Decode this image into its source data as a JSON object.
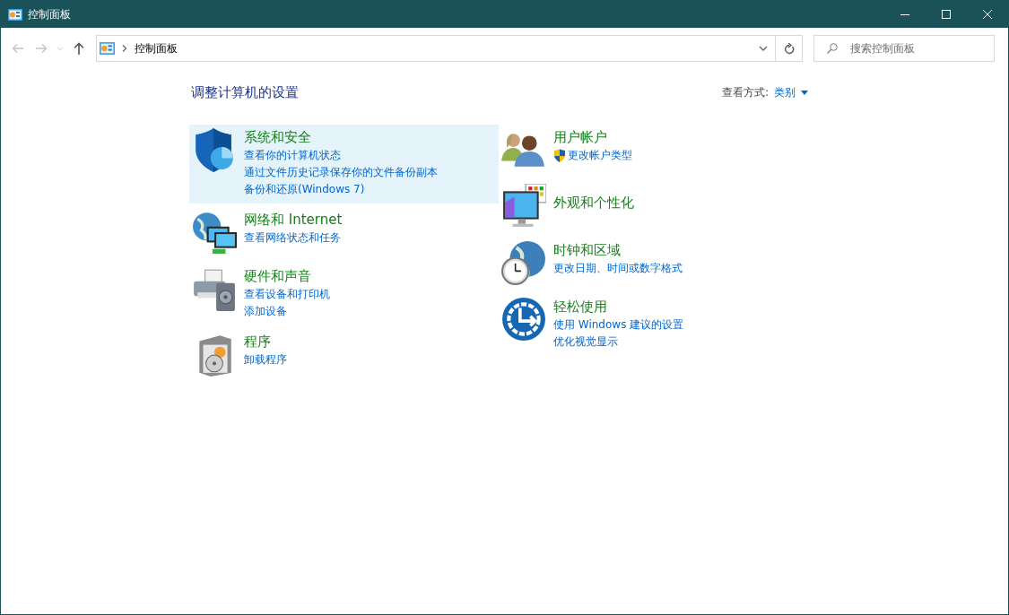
{
  "window": {
    "title": "控制面板"
  },
  "nav": {
    "back": {
      "disabled": true
    },
    "forward": {
      "disabled": true
    },
    "recent": {
      "disabled": true
    },
    "up": {
      "disabled": false
    }
  },
  "address": {
    "path": [
      "控制面板"
    ]
  },
  "search": {
    "placeholder": "搜索控制面板"
  },
  "heading": "调整计算机的设置",
  "view_by": {
    "label": "查看方式:",
    "value": "类别"
  },
  "columns": [
    {
      "categories": [
        {
          "title": "系统和安全",
          "highlighted": true,
          "links": [
            {
              "text": "查看你的计算机状态",
              "shield": false
            },
            {
              "text": "通过文件历史记录保存你的文件备份副本",
              "shield": false
            },
            {
              "text": "备份和还原(Windows 7)",
              "shield": false
            }
          ]
        },
        {
          "title": "网络和 Internet",
          "highlighted": false,
          "links": [
            {
              "text": "查看网络状态和任务",
              "shield": false
            }
          ]
        },
        {
          "title": "硬件和声音",
          "highlighted": false,
          "links": [
            {
              "text": "查看设备和打印机",
              "shield": false
            },
            {
              "text": "添加设备",
              "shield": false
            }
          ]
        },
        {
          "title": "程序",
          "highlighted": false,
          "links": [
            {
              "text": "卸载程序",
              "shield": false
            }
          ]
        }
      ]
    },
    {
      "categories": [
        {
          "title": "用户帐户",
          "highlighted": false,
          "links": [
            {
              "text": "更改帐户类型",
              "shield": true
            }
          ]
        },
        {
          "title": "外观和个性化",
          "highlighted": false
        },
        {
          "title": "时钟和区域",
          "highlighted": false,
          "links": [
            {
              "text": "更改日期、时间或数字格式",
              "shield": false
            }
          ]
        },
        {
          "title": "轻松使用",
          "highlighted": false,
          "links": [
            {
              "text": "使用 Windows 建议的设置",
              "shield": false
            },
            {
              "text": "优化视觉显示",
              "shield": false
            }
          ]
        }
      ]
    }
  ]
}
